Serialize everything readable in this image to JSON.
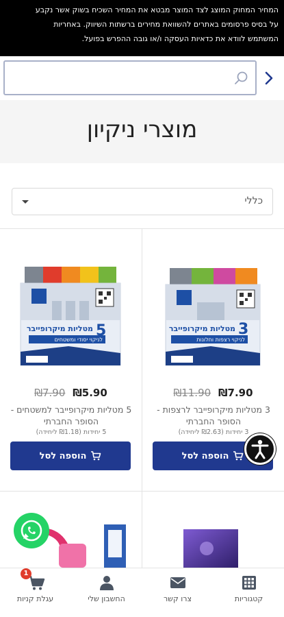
{
  "notice": {
    "line1": "המחיר המחוק המוצג לצד המוצר מבטא את המחיר השכיח בשוק אשר נקבע",
    "line2": "על בסיס פרסומים באתרים להשוואת מחירים ברשתות השיווק. באחריות",
    "line3": "המשתמש לוודא את כדאיות העסקה ו/או גובה ההפרש בפועל."
  },
  "search": {
    "placeholder": "",
    "value": ""
  },
  "page": {
    "title": "מוצרי ניקיון"
  },
  "filter": {
    "selected": "כללי"
  },
  "products": [
    {
      "price_now": "₪7.90",
      "price_was": "₪11.90",
      "name": "3 מטליות מיקרופייבר לרצפות - הסופר החברתי",
      "unit_price": "3 יחידות (₪2.63 ליחידה)",
      "add_label": "הוספה לסל",
      "pack_big_number": "3",
      "pack_title": "מטליות מיקרופייבר",
      "pack_subtitle": "לניקוי רצפות וחלונות"
    },
    {
      "price_now": "₪5.90",
      "price_was": "₪7.90",
      "name": "5 מטליות מיקרופייבר למשטחים - הסופר החברתי",
      "unit_price": "5 יחידות (₪1.18 ליחידה)",
      "add_label": "הוספה לסל",
      "pack_big_number": "5",
      "pack_title": "מטליות מיקרופייבר",
      "pack_subtitle": "לניקוי יסודי ומשטחים"
    }
  ],
  "bottom_nav": [
    {
      "label": "קטגוריות",
      "icon": "grid-icon"
    },
    {
      "label": "צרו קשר",
      "icon": "envelope-icon"
    },
    {
      "label": "החשבון שלי",
      "icon": "user-icon"
    },
    {
      "label": "עגלת קניות",
      "icon": "cart-icon",
      "badge": "1"
    }
  ],
  "colors": {
    "primary": "#20398f",
    "notice_bg": "#000000",
    "badge": "#e03c2c",
    "whatsapp": "#25d366"
  }
}
